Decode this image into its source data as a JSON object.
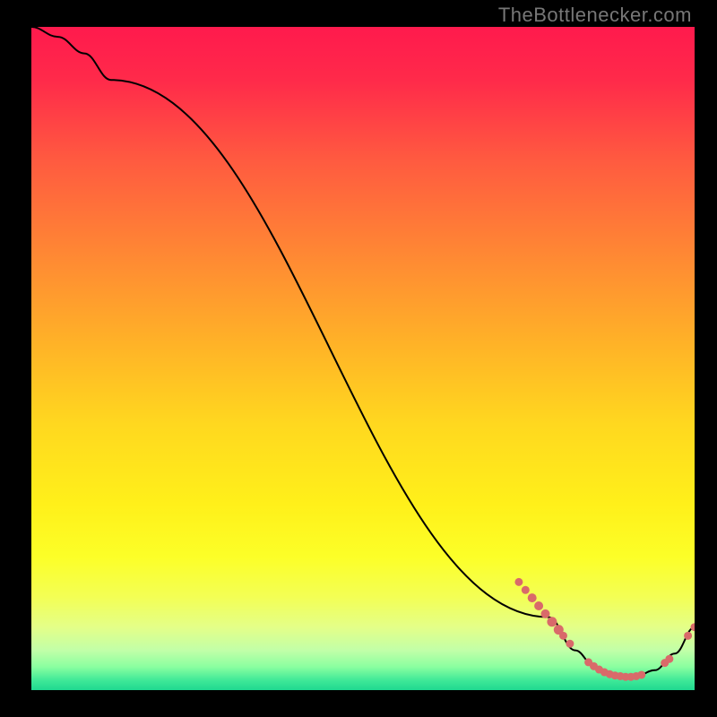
{
  "attribution": "TheBottlenecker.com",
  "chart_data": {
    "type": "line",
    "title": "",
    "xlabel": "",
    "ylabel": "",
    "xlim": [
      0,
      100
    ],
    "ylim": [
      0,
      100
    ],
    "curve": [
      {
        "x": 0,
        "y": 100
      },
      {
        "x": 4,
        "y": 98.5
      },
      {
        "x": 8,
        "y": 96
      },
      {
        "x": 12,
        "y": 92
      },
      {
        "x": 78,
        "y": 11
      },
      {
        "x": 82,
        "y": 6
      },
      {
        "x": 85,
        "y": 3.5
      },
      {
        "x": 88,
        "y": 2.2
      },
      {
        "x": 91,
        "y": 2.0
      },
      {
        "x": 94,
        "y": 3.0
      },
      {
        "x": 97,
        "y": 5.5
      },
      {
        "x": 100,
        "y": 9.5
      }
    ],
    "markers": [
      {
        "x": 73.5,
        "y": 16.3,
        "r": 4.5
      },
      {
        "x": 74.5,
        "y": 15.1,
        "r": 4.5
      },
      {
        "x": 75.5,
        "y": 13.9,
        "r": 5
      },
      {
        "x": 76.5,
        "y": 12.7,
        "r": 5
      },
      {
        "x": 77.5,
        "y": 11.5,
        "r": 5
      },
      {
        "x": 78.5,
        "y": 10.3,
        "r": 5.5
      },
      {
        "x": 79.5,
        "y": 9.1,
        "r": 5.5
      },
      {
        "x": 80.2,
        "y": 8.2,
        "r": 4.5
      },
      {
        "x": 81.2,
        "y": 7.0,
        "r": 4.5
      },
      {
        "x": 84.0,
        "y": 4.2,
        "r": 4.5
      },
      {
        "x": 84.8,
        "y": 3.6,
        "r": 4.5
      },
      {
        "x": 85.6,
        "y": 3.1,
        "r": 4.5
      },
      {
        "x": 86.4,
        "y": 2.7,
        "r": 4.5
      },
      {
        "x": 87.2,
        "y": 2.4,
        "r": 4.5
      },
      {
        "x": 88.0,
        "y": 2.2,
        "r": 4.5
      },
      {
        "x": 88.8,
        "y": 2.1,
        "r": 4.5
      },
      {
        "x": 89.6,
        "y": 2.0,
        "r": 4.5
      },
      {
        "x": 90.4,
        "y": 2.0,
        "r": 4.5
      },
      {
        "x": 91.2,
        "y": 2.1,
        "r": 4.5
      },
      {
        "x": 92.0,
        "y": 2.3,
        "r": 4.5
      },
      {
        "x": 95.5,
        "y": 4.1,
        "r": 4.5
      },
      {
        "x": 96.2,
        "y": 4.7,
        "r": 4.5
      },
      {
        "x": 99.0,
        "y": 8.2,
        "r": 4.5
      },
      {
        "x": 100.0,
        "y": 9.5,
        "r": 4.5
      }
    ],
    "marker_color": "#d96a6a",
    "line_color": "#000000",
    "gradient_stops": [
      {
        "offset": 0.0,
        "color": "#ff1a4d"
      },
      {
        "offset": 0.08,
        "color": "#ff2a4a"
      },
      {
        "offset": 0.2,
        "color": "#ff5a40"
      },
      {
        "offset": 0.35,
        "color": "#ff8a33"
      },
      {
        "offset": 0.48,
        "color": "#ffb327"
      },
      {
        "offset": 0.6,
        "color": "#ffd81f"
      },
      {
        "offset": 0.72,
        "color": "#fff01a"
      },
      {
        "offset": 0.8,
        "color": "#fcff28"
      },
      {
        "offset": 0.86,
        "color": "#f3ff55"
      },
      {
        "offset": 0.905,
        "color": "#e4ff88"
      },
      {
        "offset": 0.94,
        "color": "#c2ffa8"
      },
      {
        "offset": 0.965,
        "color": "#8affa0"
      },
      {
        "offset": 0.985,
        "color": "#40e998"
      },
      {
        "offset": 1.0,
        "color": "#1fd890"
      }
    ]
  }
}
